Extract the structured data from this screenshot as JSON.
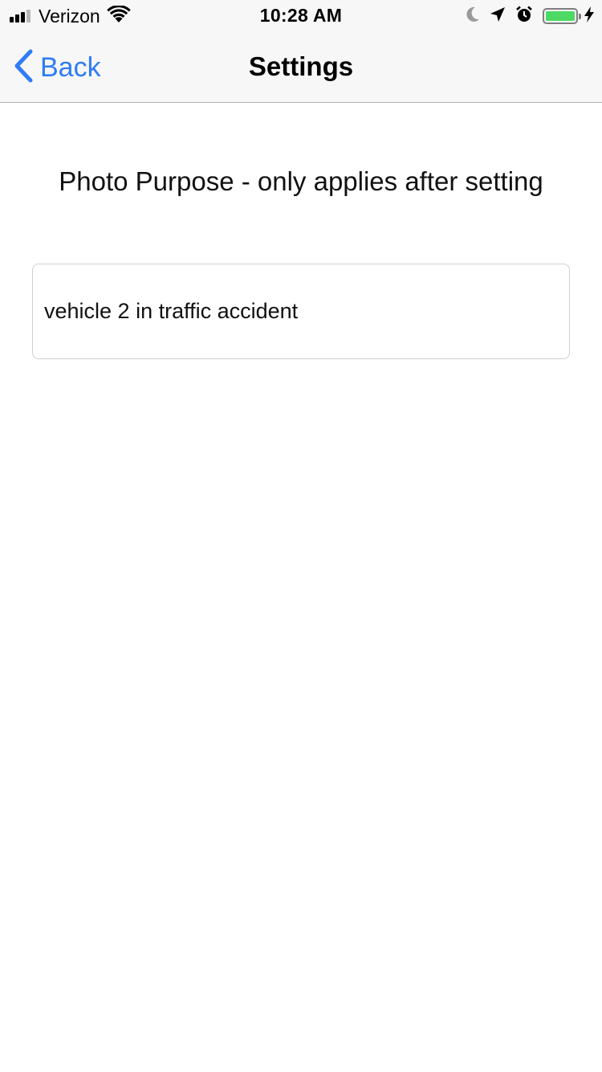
{
  "status_bar": {
    "carrier": "Verizon",
    "time": "10:28 AM",
    "battery_color": "#4cd964",
    "icons": [
      "cellular-signal-icon",
      "wifi-icon",
      "moon-icon",
      "location-arrow-icon",
      "alarm-clock-icon",
      "battery-icon",
      "charging-bolt-icon"
    ]
  },
  "nav": {
    "back_label": "Back",
    "title": "Settings",
    "accent_color": "#2f7cf6"
  },
  "main": {
    "heading": "Photo Purpose - only applies after setting",
    "purpose_value": "vehicle 2 in traffic accident"
  }
}
